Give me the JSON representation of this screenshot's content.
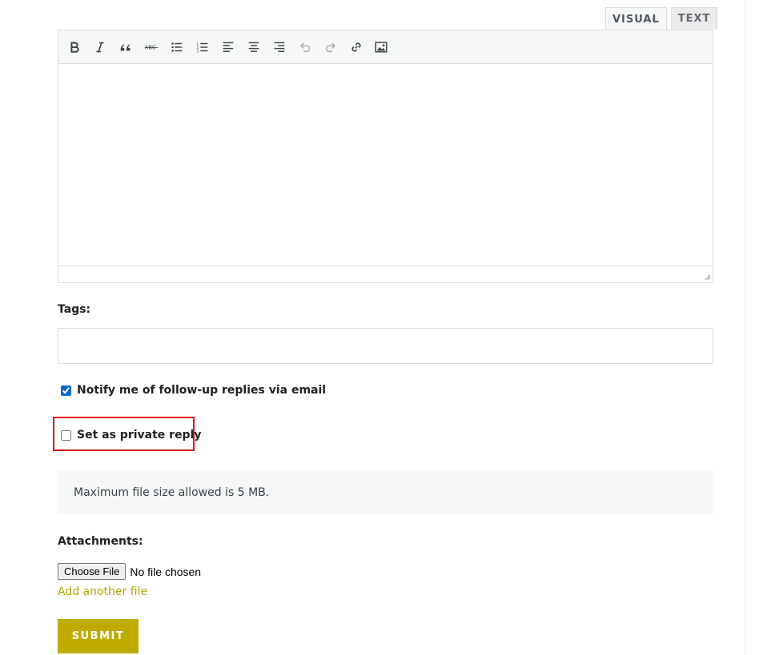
{
  "editor": {
    "tabs": [
      {
        "label": "VISUAL",
        "active": true
      },
      {
        "label": "TEXT",
        "active": false
      }
    ],
    "toolbar_icons": [
      "bold-icon",
      "italic-icon",
      "blockquote-icon",
      "strikethrough-icon",
      "bullet-list-icon",
      "numbered-list-icon",
      "align-left-icon",
      "align-center-icon",
      "align-right-icon",
      "undo-icon",
      "redo-icon",
      "link-icon",
      "image-icon"
    ]
  },
  "tags": {
    "label": "Tags:",
    "value": ""
  },
  "notify": {
    "label": "Notify me of follow-up replies via email",
    "checked": true
  },
  "private_reply": {
    "label": "Set as private reply",
    "checked": false
  },
  "notice": {
    "text": "Maximum file size allowed is 5 MB."
  },
  "attachments": {
    "label": "Attachments:",
    "choose_button": "Choose File",
    "status": "No file chosen",
    "add_another": "Add another file"
  },
  "submit": {
    "label": "SUBMIT"
  },
  "colors": {
    "accent": "#bfab00",
    "link": "#b5a700",
    "highlight": "#e3111c"
  }
}
